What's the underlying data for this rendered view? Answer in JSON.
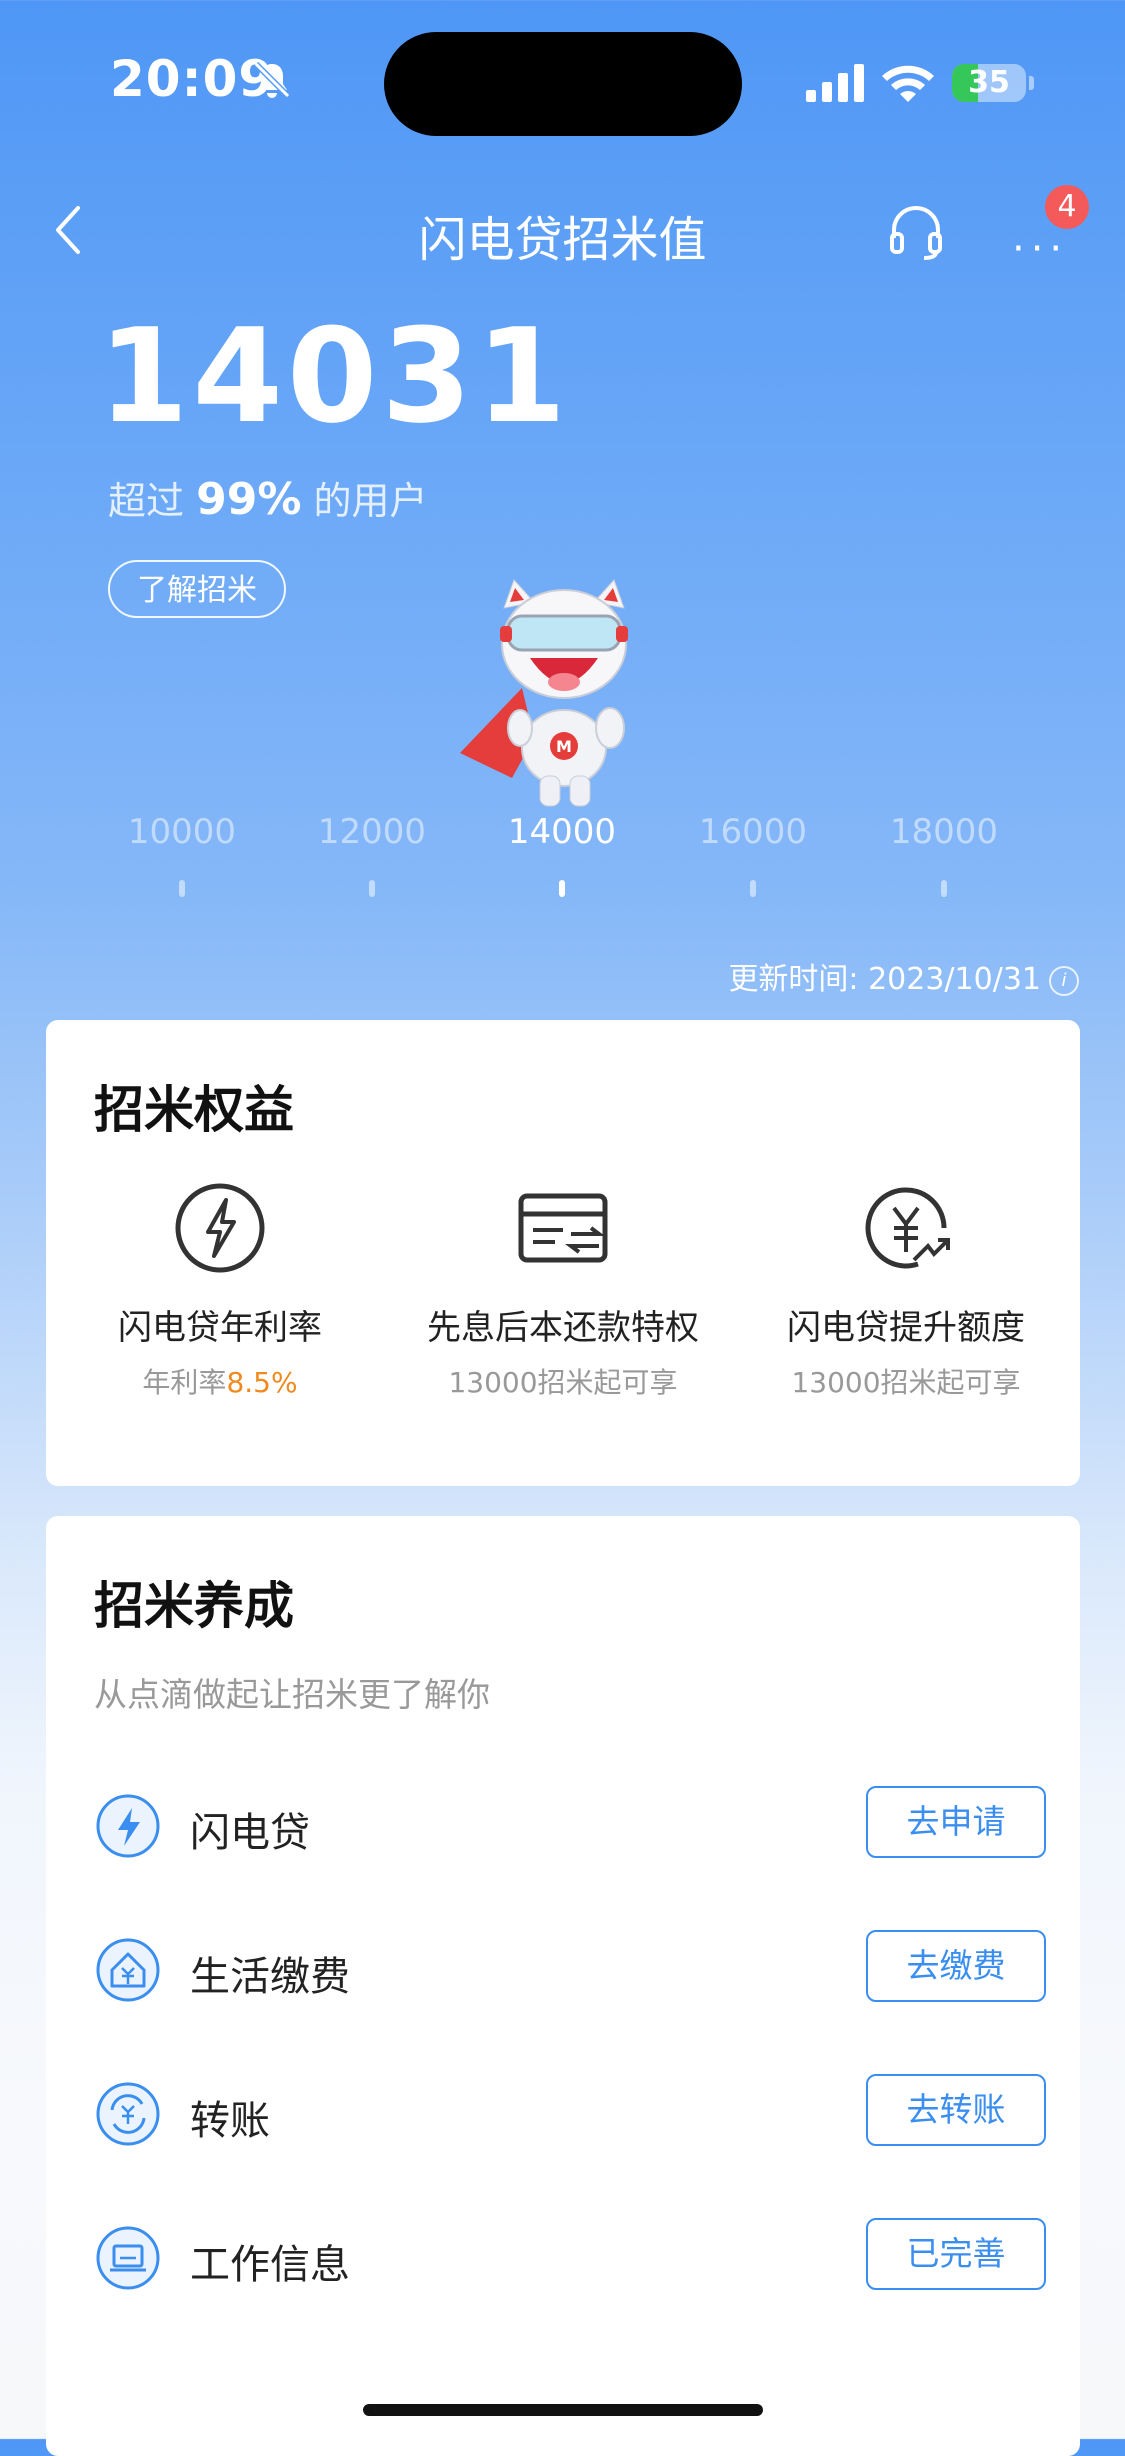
{
  "status_bar": {
    "time": "20:09",
    "battery": "35",
    "battery_level": 0.35
  },
  "nav": {
    "title": "闪电贷招米值",
    "badge": "4",
    "more": "···"
  },
  "score": {
    "value": "14031",
    "exceed_prefix": "超过",
    "exceed_pct": "99%",
    "exceed_suffix": "的用户",
    "learn_label": "了解招米"
  },
  "scale": {
    "ticks": [
      "10000",
      "12000",
      "14000",
      "16000",
      "18000"
    ],
    "current_index": 2
  },
  "update": {
    "label": "更新时间: 2023/10/31",
    "info": "i"
  },
  "benefits": {
    "title": "招米权益",
    "items": [
      {
        "name": "闪电贷年利率",
        "sub_prefix": "年利率",
        "sub_highlight": "8.5%",
        "icon": "lightning-circle-icon"
      },
      {
        "name": "先息后本还款特权",
        "sub_prefix": "13000招米起可享",
        "sub_highlight": "",
        "icon": "card-transfer-icon"
      },
      {
        "name": "闪电贷提升额度",
        "sub_prefix": "13000招米起可享",
        "sub_highlight": "",
        "icon": "yen-growth-icon"
      }
    ]
  },
  "cultivate": {
    "title": "招米养成",
    "subtitle": "从点滴做起让招米更了解你",
    "rows": [
      {
        "label": "闪电贷",
        "button": "去申请",
        "icon": "lightning-icon"
      },
      {
        "label": "生活缴费",
        "button": "去缴费",
        "icon": "house-yen-icon"
      },
      {
        "label": "转账",
        "button": "去转账",
        "icon": "transfer-yen-icon"
      },
      {
        "label": "工作信息",
        "button": "已完善",
        "icon": "laptop-icon"
      }
    ]
  },
  "colors": {
    "accent": "#3a8ef0",
    "highlight": "#f08a1f",
    "badge": "#f45a5a"
  }
}
